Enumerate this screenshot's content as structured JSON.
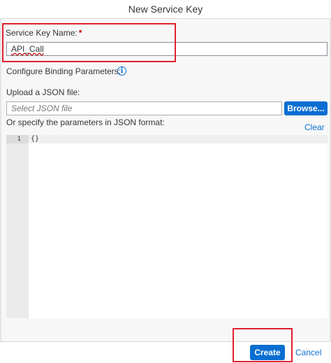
{
  "dialog": {
    "title": "New Service Key"
  },
  "service_key": {
    "label": "Service Key Name:",
    "required_mark": "*",
    "value": "API_Call"
  },
  "binding": {
    "label": "Configure Binding Parameters:",
    "info_icon": "i"
  },
  "upload": {
    "label": "Upload a JSON file:",
    "placeholder": "Select JSON file",
    "browse_label": "Browse..."
  },
  "json_format": {
    "label": "Or specify the parameters in JSON format:",
    "clear_label": "Clear"
  },
  "editor": {
    "line_number": "1",
    "content": "{}"
  },
  "footer": {
    "create_label": "Create",
    "cancel_label": "Cancel"
  },
  "colors": {
    "accent": "#0a6ed1",
    "required": "#bb0000",
    "highlight": "#e0202e"
  }
}
